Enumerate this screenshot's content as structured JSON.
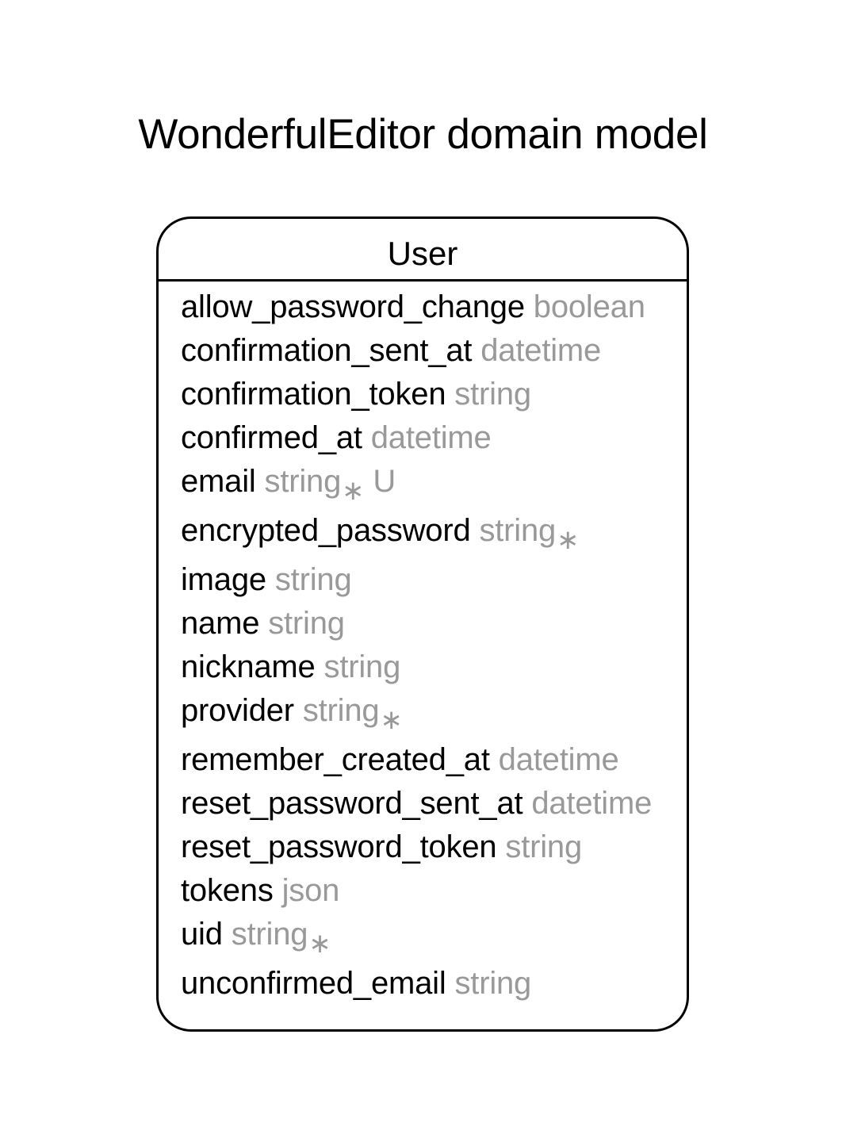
{
  "diagram": {
    "title": "WonderfulEditor domain model"
  },
  "entity": {
    "name": "User",
    "attributes": [
      {
        "name": "allow_password_change",
        "type": "boolean",
        "mark": "",
        "flag": ""
      },
      {
        "name": "confirmation_sent_at",
        "type": "datetime",
        "mark": "",
        "flag": ""
      },
      {
        "name": "confirmation_token",
        "type": "string",
        "mark": "",
        "flag": ""
      },
      {
        "name": "confirmed_at",
        "type": "datetime",
        "mark": "",
        "flag": ""
      },
      {
        "name": "email",
        "type": "string",
        "mark": "∗",
        "flag": "U"
      },
      {
        "name": "encrypted_password",
        "type": "string",
        "mark": "∗",
        "flag": ""
      },
      {
        "name": "image",
        "type": "string",
        "mark": "",
        "flag": ""
      },
      {
        "name": "name",
        "type": "string",
        "mark": "",
        "flag": ""
      },
      {
        "name": "nickname",
        "type": "string",
        "mark": "",
        "flag": ""
      },
      {
        "name": "provider",
        "type": "string",
        "mark": "∗",
        "flag": ""
      },
      {
        "name": "remember_created_at",
        "type": "datetime",
        "mark": "",
        "flag": ""
      },
      {
        "name": "reset_password_sent_at",
        "type": "datetime",
        "mark": "",
        "flag": ""
      },
      {
        "name": "reset_password_token",
        "type": "string",
        "mark": "",
        "flag": ""
      },
      {
        "name": "tokens",
        "type": "json",
        "mark": "",
        "flag": ""
      },
      {
        "name": "uid",
        "type": "string",
        "mark": "∗",
        "flag": ""
      },
      {
        "name": "unconfirmed_email",
        "type": "string",
        "mark": "",
        "flag": ""
      }
    ]
  }
}
